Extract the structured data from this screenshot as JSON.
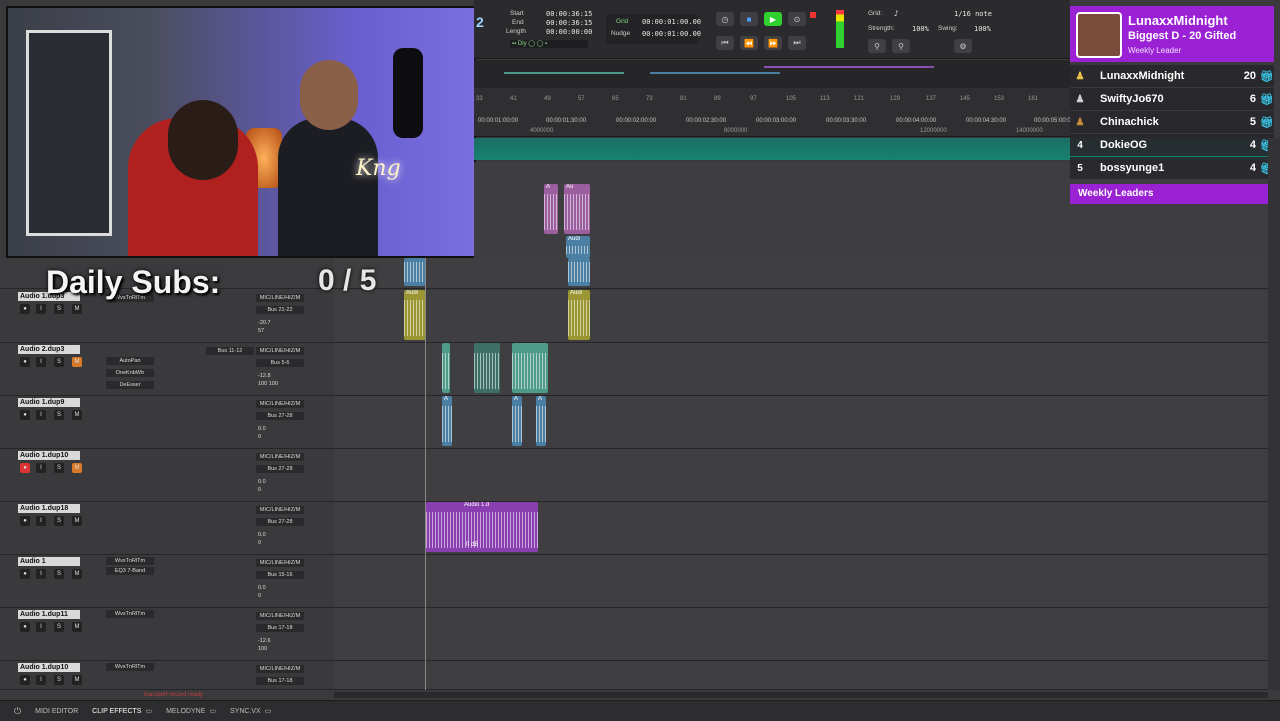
{
  "transport": {
    "start_label": "Start",
    "start_value": "00:00:36:15",
    "end_label": "End",
    "end_value": "00:00:36:15",
    "length_label": "Length",
    "length_value": "00:00:00:00",
    "grid_label": "Grid",
    "grid_value": "00:00:01:00.00",
    "nudge_label": "Nudge",
    "nudge_value": "00:00:01:00.00",
    "quant_grid_label": "Grid:",
    "quant_grid_value": "1/16 note",
    "strength_label": "Strength:",
    "strength_value": "100%",
    "swing_label": "Swing:",
    "swing_value": "100%",
    "counter_fragment": "2"
  },
  "ruler": {
    "bars": [
      "33",
      "41",
      "49",
      "57",
      "65",
      "73",
      "81",
      "89",
      "97",
      "105",
      "113",
      "121",
      "129",
      "137",
      "145",
      "153",
      "161"
    ],
    "times": [
      "00:00:01:00:00",
      "00:00:01:30:00",
      "00:00:02:00:00",
      "00:00:02:30:00",
      "00:00:03:00:00",
      "00:00:03:30:00",
      "00:00:04:00:00",
      "00:00:04:30:00",
      "00:00:05:00:00"
    ],
    "samples": [
      "4000000",
      "8000000",
      "12000000",
      "14000000"
    ]
  },
  "overlay": {
    "daily_subs_label": "Daily Subs:",
    "daily_subs_value": "0 / 5"
  },
  "leaderboard": {
    "top_name": "LunaxxMidnight",
    "top_sub": "Biggest D - 20 Gifted",
    "top_caption": "Weekly Leader",
    "rows": [
      {
        "rank": "1",
        "name": "LunaxxMidnight",
        "count": "20"
      },
      {
        "rank": "2",
        "name": "SwiftyJo670",
        "count": "6"
      },
      {
        "rank": "3",
        "name": "Chinachick",
        "count": "5"
      },
      {
        "rank": "4",
        "name": "DokieOG",
        "count": "4"
      },
      {
        "rank": "5",
        "name": "bossyunge1",
        "count": "4"
      }
    ],
    "footer": "Weekly Leaders"
  },
  "tracks": [
    {
      "name": "Audio 1.dup3",
      "inserts": [
        "WvsTnRlTm"
      ],
      "io": "MIC/LINE/HIZ/M",
      "bus": "Bus 21-22",
      "vol": "-20.7",
      "pan": "57"
    },
    {
      "name": "Audio 2.dup3",
      "inserts": [
        "AutoPan",
        "OneKnbWtr",
        "DeEsser"
      ],
      "send": "Bus 11-12",
      "io": "MIC/LINE/HIZ/M",
      "bus": "Bus 5-6",
      "vol": "-12.8",
      "pan": "100 100"
    },
    {
      "name": "Audio 1.dup9",
      "inserts": [],
      "io": "MIC/LINE/HIZ/M",
      "bus": "Bus 27-28",
      "vol": "0.0",
      "pan": "0"
    },
    {
      "name": "Audio 1.dup10",
      "inserts": [],
      "io": "MIC/LINE/HIZ/M",
      "bus": "Bus 27-28",
      "vol": "0.0",
      "pan": "0"
    },
    {
      "name": "Audio 1.dup18",
      "inserts": [],
      "io": "MIC/LINE/HIZ/M",
      "bus": "Bus 27-28",
      "vol": "0.0",
      "pan": "0"
    },
    {
      "name": "Audio 1",
      "inserts": [
        "WvsTnRlTm",
        "EQ3 7-Band"
      ],
      "io": "MIC/LINE/HIZ/M",
      "bus": "Bus 15-16",
      "vol": "0.0",
      "pan": "0"
    },
    {
      "name": "Audio 1.dup11",
      "inserts": [
        "WvsTnRlTm"
      ],
      "io": "MIC/LINE/HIZ/M",
      "bus": "Bus 17-18",
      "vol": "-12.6",
      "pan": "100"
    },
    {
      "name": "Audio 1.dup10",
      "inserts": [
        "WvsTnRlTm"
      ],
      "io": "MIC/LINE/HIZ/M",
      "bus": "Bus 17-18",
      "vol": "",
      "pan": ""
    }
  ],
  "clip_labels": {
    "purple_group": "Audio 1.d",
    "gain": "0 dB"
  },
  "bottom": {
    "tabs": [
      "MIDI EDITOR",
      "CLIP EFFECTS",
      "MELODYNE",
      "SYNC.VX"
    ],
    "status": "transport record ready"
  }
}
